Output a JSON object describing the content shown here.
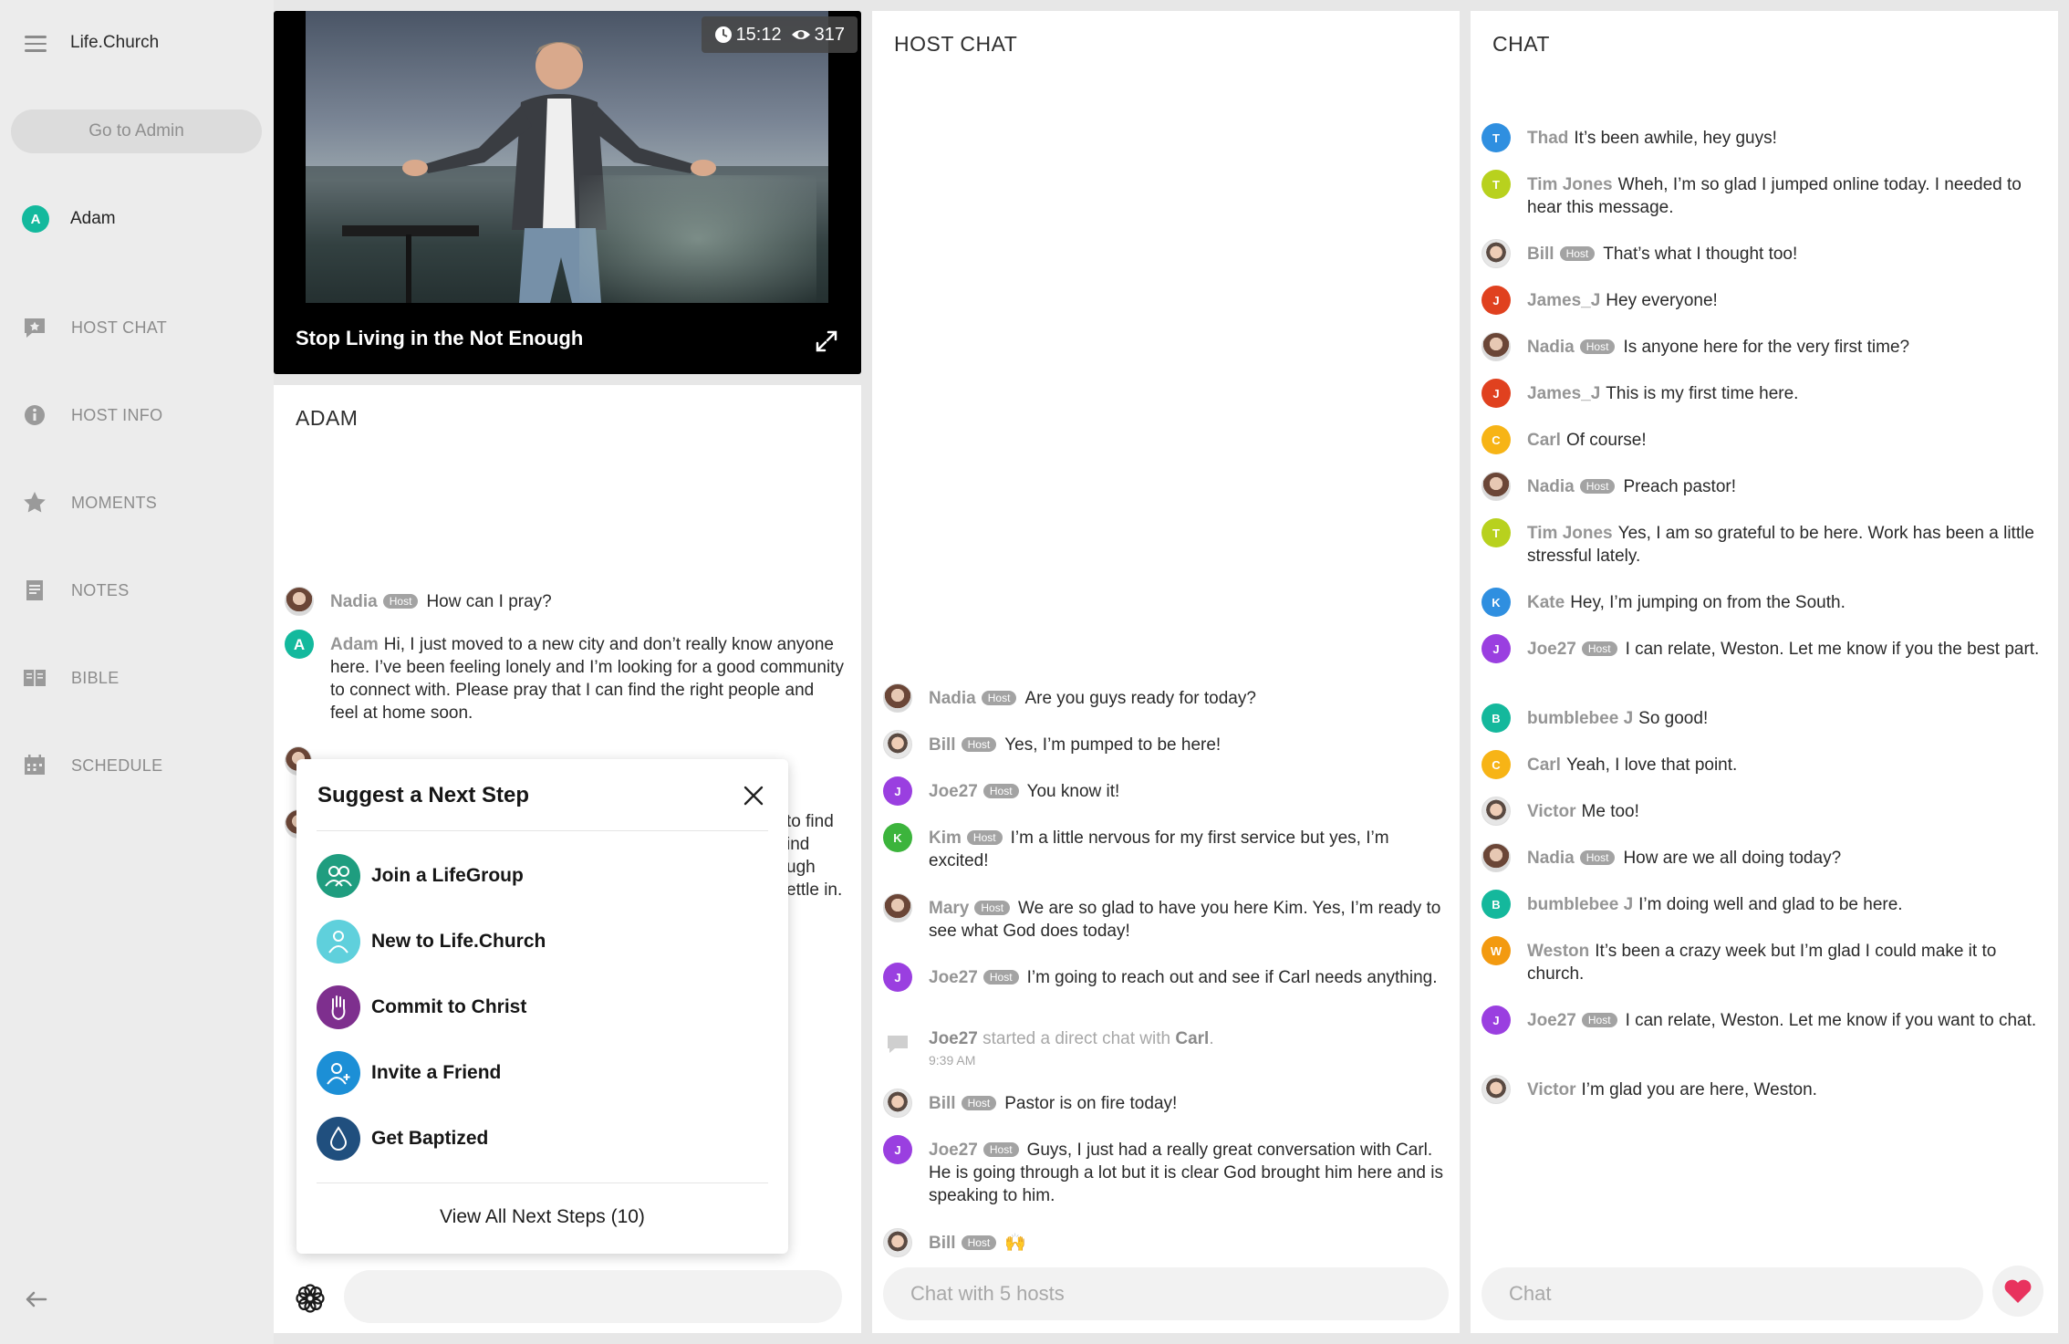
{
  "app": {
    "brand": "Life.Church",
    "admin_button": "Go to Admin"
  },
  "user": {
    "name": "Adam",
    "initial": "A"
  },
  "nav": [
    {
      "label": "HOST CHAT",
      "icon": "star-chat-icon"
    },
    {
      "label": "HOST INFO",
      "icon": "info-icon"
    },
    {
      "label": "MOMENTS",
      "icon": "star-icon"
    },
    {
      "label": "NOTES",
      "icon": "notes-icon"
    },
    {
      "label": "BIBLE",
      "icon": "bible-icon"
    },
    {
      "label": "SCHEDULE",
      "icon": "calendar-icon"
    }
  ],
  "video": {
    "time": "15:12",
    "viewers": "317",
    "title": "Stop Living in the Not Enough"
  },
  "adam_panel": {
    "title": "ADAM",
    "messages": [
      {
        "user": "Nadia",
        "host": "Host",
        "text": "How can I pray?"
      },
      {
        "user": "Adam",
        "initial": "A",
        "text": "Hi, I just moved to a new city and don’t really know anyone here. I’ve been feeling lonely and I’m looking for a good community to connect with. Please pray that I can find the right people and feel at home soon."
      }
    ],
    "hidden_fragments": [
      "to find",
      "ind",
      "ugh",
      "ettle in."
    ]
  },
  "popup": {
    "title": "Suggest a Next Step",
    "steps": [
      {
        "label": "Join a LifeGroup",
        "color": "#1f9d7f"
      },
      {
        "label": "New to Life.Church",
        "color": "#5fd0dc"
      },
      {
        "label": "Commit to Christ",
        "color": "#7e2f8e"
      },
      {
        "label": "Invite a Friend",
        "color": "#1c8fd6"
      },
      {
        "label": "Get Baptized",
        "color": "#204f7e"
      }
    ],
    "view_all": "View All Next Steps (10)"
  },
  "host_chat": {
    "title": "HOST CHAT",
    "placeholder": "Chat with 5 hosts",
    "messages": [
      {
        "user": "Nadia",
        "host": "Host",
        "text": "Are you guys ready for today?"
      },
      {
        "user": "Bill",
        "host": "Host",
        "text": "Yes, I’m pumped to be here!"
      },
      {
        "user": "Joe27",
        "host": "Host",
        "initial": "J",
        "text": "You know it!"
      },
      {
        "user": "Kim",
        "host": "Host",
        "initial": "K",
        "text": "I’m a little nervous for my first service but yes, I’m excited!"
      },
      {
        "user": "Mary",
        "host": "Host",
        "text": "We are so glad to have you here Kim. Yes, I’m ready to see what God does today!"
      },
      {
        "user": "Joe27",
        "host": "Host",
        "initial": "J",
        "text": "I’m going to reach out and see if Carl needs anything."
      },
      {
        "user": "Bill",
        "host": "Host",
        "text": "Pastor is on fire today!"
      },
      {
        "user": "Joe27",
        "host": "Host",
        "initial": "J",
        "text": "Guys, I just had a really great conversation with Carl. He is going through a lot but it is clear God brought him here and is speaking to him."
      },
      {
        "user": "Bill",
        "host": "Host",
        "text": "🙌"
      }
    ],
    "system": {
      "actor": "Joe27",
      "action": "started a direct chat with",
      "target": "Carl",
      "time": "9:39 AM"
    }
  },
  "chat": {
    "title": "CHAT",
    "placeholder": "Chat",
    "messages": [
      {
        "user": "Thad",
        "initial": "T",
        "color": "#2f8fe0",
        "text": "It’s been awhile, hey guys!"
      },
      {
        "user": "Tim Jones",
        "initial": "T",
        "color": "#b8d11e",
        "text": "Wheh, I’m so glad I jumped online today. I needed to hear this message."
      },
      {
        "user": "Bill",
        "host": "Host",
        "text": "That’s what I thought too!"
      },
      {
        "user": "James_J",
        "initial": "J",
        "color": "#e0411f",
        "text": "Hey everyone!"
      },
      {
        "user": "Nadia",
        "host": "Host",
        "text": "Is anyone here for the very first time?"
      },
      {
        "user": "James_J",
        "initial": "J",
        "color": "#e0411f",
        "text": "This is my first time here."
      },
      {
        "user": "Carl",
        "initial": "C",
        "color": "#f7b416",
        "text": "Of course!"
      },
      {
        "user": "Nadia",
        "host": "Host",
        "text": "Preach pastor!"
      },
      {
        "user": "Tim Jones",
        "initial": "T",
        "color": "#b8d11e",
        "text": "Yes, I am so grateful to be here. Work has been a little stressful lately."
      },
      {
        "user": "Kate",
        "initial": "K",
        "color": "#2f8fe0",
        "text": "Hey, I’m jumping on from the South."
      },
      {
        "user": "Joe27",
        "host": "Host",
        "initial": "J",
        "color": "#9a3fe0",
        "text": "I can relate, Weston. Let me know if you the best part."
      },
      {
        "user": "bumblebee J",
        "initial": "B",
        "color": "#14b89c",
        "text": "So good!"
      },
      {
        "user": "Carl",
        "initial": "C",
        "color": "#f7b416",
        "text": "Yeah, I love that point."
      },
      {
        "user": "Victor",
        "text": "Me too!"
      },
      {
        "user": "Nadia",
        "host": "Host",
        "text": "How are we all doing today?"
      },
      {
        "user": "bumblebee J",
        "initial": "B",
        "color": "#14b89c",
        "text": "I’m doing well and glad to be here."
      },
      {
        "user": "Weston",
        "initial": "W",
        "color": "#f39a10",
        "text": "It’s been a crazy week but I’m glad I could make it to church."
      },
      {
        "user": "Joe27",
        "host": "Host",
        "initial": "J",
        "color": "#9a3fe0",
        "text": "I can relate, Weston. Let me know if you want to chat."
      },
      {
        "user": "Victor",
        "text": "I’m glad you are here, Weston."
      }
    ]
  }
}
